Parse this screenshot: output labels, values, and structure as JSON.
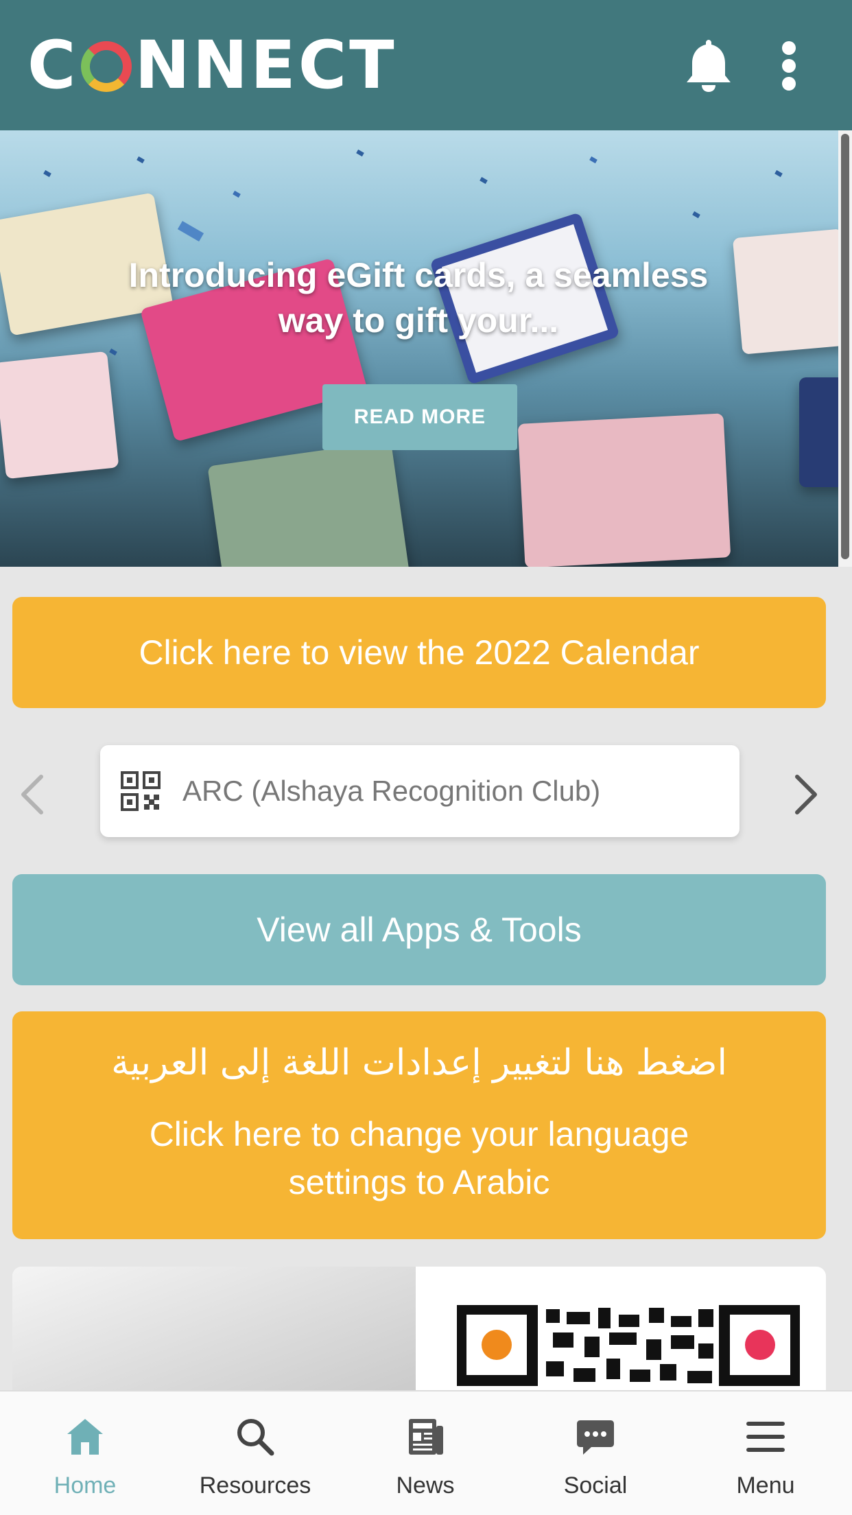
{
  "header": {
    "logo_text": "CONNECT",
    "icons": [
      "bell-icon",
      "more-vertical-icon"
    ]
  },
  "hero": {
    "title": "Introducing eGift cards, a seamless way to gift your...",
    "read_more_label": "READ MORE"
  },
  "calendar_button": {
    "label": "Click here to view the 2022 Calendar"
  },
  "apps_carousel": {
    "item_label": "ARC (Alshaya Recognition Club)",
    "item_icon": "qr-code-icon",
    "prev_icon": "chevron-left-icon",
    "next_icon": "chevron-right-icon"
  },
  "apps_button": {
    "label": "View all Apps & Tools"
  },
  "language_button": {
    "arabic_label": "اضغط هنا لتغيير إعدادات اللغة إلى العربية",
    "english_label": "Click here to change your language settings to Arabic"
  },
  "tabbar": {
    "items": [
      {
        "label": "Home",
        "icon": "home-icon",
        "active": true
      },
      {
        "label": "Resources",
        "icon": "search-icon",
        "active": false
      },
      {
        "label": "News",
        "icon": "newspaper-icon",
        "active": false
      },
      {
        "label": "Social",
        "icon": "chat-icon",
        "active": false
      },
      {
        "label": "Menu",
        "icon": "hamburger-icon",
        "active": false
      }
    ]
  },
  "colors": {
    "header": "#41787d",
    "yellow": "#f6b534",
    "teal": "#82bcc1",
    "active_tab": "#6fb0b6"
  }
}
